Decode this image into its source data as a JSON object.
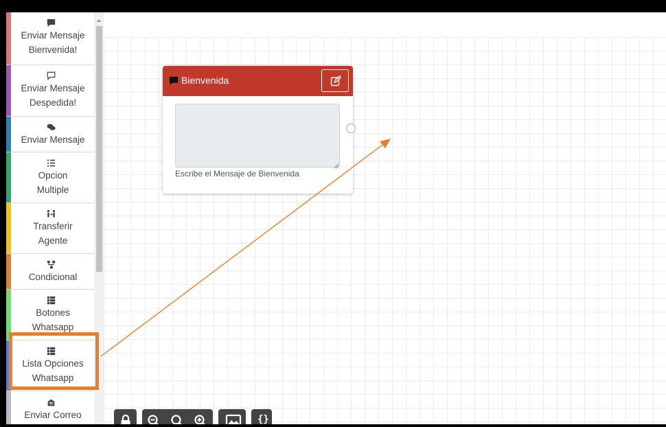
{
  "sidebar": {
    "items": [
      {
        "label_1": "Enviar Mensaje",
        "label_2": "Bienvenida!",
        "icon": "comment-solid-icon",
        "color": "#e57373"
      },
      {
        "label_1": "Enviar Mensaje",
        "label_2": "Despedida!",
        "icon": "comment-outline-icon",
        "color": "#9b59b6"
      },
      {
        "label_1": "Enviar Mensaje",
        "label_2": "",
        "icon": "comments-icon",
        "color": "#2980b9"
      },
      {
        "label_1": "Opcion",
        "label_2": "Multiple",
        "icon": "list-ol-icon",
        "color": "#27ae60"
      },
      {
        "label_1": "Transferir",
        "label_2": "Agente",
        "icon": "user-transfer-icon",
        "color": "#f1c40f"
      },
      {
        "label_1": "Condicional",
        "label_2": "",
        "icon": "sitemap-icon",
        "color": "#e67e22"
      },
      {
        "label_1": "Botones",
        "label_2": "Whatsapp",
        "icon": "th-list-icon",
        "color": "#6ee06e"
      },
      {
        "label_1": "Lista Opciones",
        "label_2": "Whatsapp",
        "icon": "th-list-icon",
        "color": "#5b7cd8"
      },
      {
        "label_1": "Enviar Correo",
        "label_2": "",
        "icon": "envelope-open-icon",
        "color": "#b0bec5"
      }
    ]
  },
  "node": {
    "title": "Bienvenida",
    "header_color": "#c0392b",
    "textarea_value": "",
    "caption": "Escribe el Mensaje de Bienvenida"
  },
  "annotation": {
    "highlight_color": "#e87d2c"
  },
  "toolbar": {
    "buttons": [
      "lock-icon",
      "zoom-out-icon",
      "zoom-reset-icon",
      "zoom-in-icon",
      "export-image-icon",
      "json-code-icon"
    ],
    "json_label": "{}"
  }
}
